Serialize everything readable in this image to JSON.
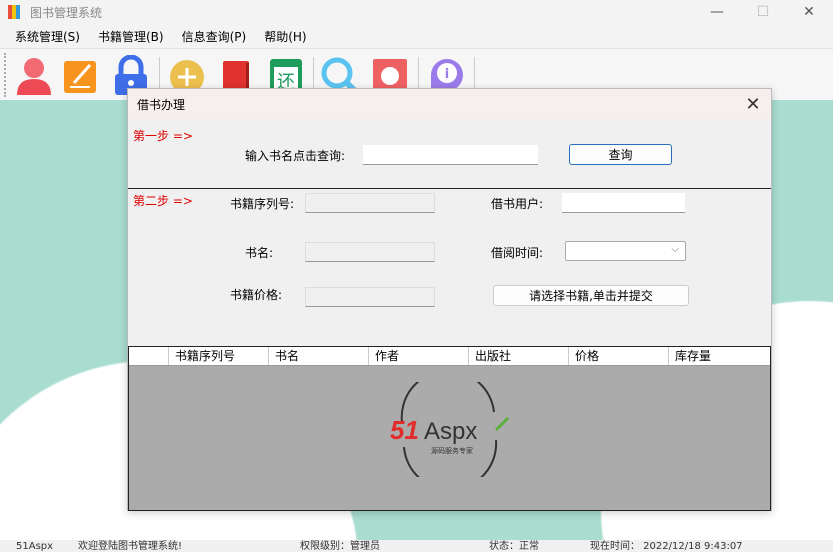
{
  "window": {
    "title": "图书管理系统",
    "minimize": "—",
    "maximize": "☐",
    "close": "✕"
  },
  "menu": [
    "系统管理(S)",
    "书籍管理(B)",
    "信息查询(P)",
    "帮助(H)"
  ],
  "toolbar": [
    "user-icon",
    "edit-icon",
    "lock-icon",
    "add-icon",
    "book-icon",
    "return-book-icon",
    "search-icon",
    "message-icon",
    "info-icon"
  ],
  "toolbar_return_char": "还",
  "dialog": {
    "title": "借书办理",
    "close": "✕",
    "step1": "第一步 =>",
    "search_label": "输入书名点击查询:",
    "search_value": "",
    "search_button": "查询",
    "step2": "第二步 =>",
    "serial_label": "书籍序列号:",
    "name_label": "书名:",
    "price_label": "书籍价格:",
    "user_label": "借书用户:",
    "time_label": "借阅时间:",
    "submit_button": "请选择书籍,单击并提交"
  },
  "grid": {
    "columns": [
      "书籍序列号",
      "书名",
      "作者",
      "出版社",
      "价格",
      "库存量"
    ]
  },
  "logo": {
    "text": "51Aspx",
    "tagline": "源码服务专家"
  },
  "status": {
    "brand": "51Aspx",
    "welcome": "欢迎登陆图书管理系统!",
    "role": "权限级别：管理员",
    "state": "状态：正常",
    "time": "现在时间：  2022/12/18 9:43:07"
  }
}
